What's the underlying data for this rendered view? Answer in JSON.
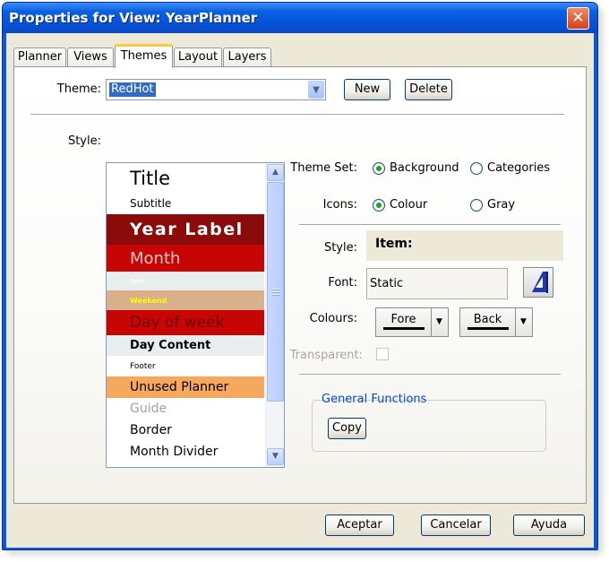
{
  "window": {
    "title": "Properties for View: YearPlanner",
    "close_glyph": "✕"
  },
  "tabs": [
    {
      "label": "Planner"
    },
    {
      "label": "Views"
    },
    {
      "label": "Themes"
    },
    {
      "label": "Layout"
    },
    {
      "label": "Layers"
    }
  ],
  "active_tab": "Themes",
  "theme": {
    "label": "Theme:",
    "value": "RedHot",
    "new_label": "New",
    "delete_label": "Delete"
  },
  "style_list": {
    "label": "Style:",
    "items": [
      {
        "text": "Title",
        "bg": "#ffffff",
        "fg": "#000000"
      },
      {
        "text": "Subtitle",
        "bg": "#ffffff",
        "fg": "#000000"
      },
      {
        "text": "Year Label",
        "bg": "#8b0a0a",
        "fg": "#ffffff"
      },
      {
        "text": "Month",
        "bg": "#c80505",
        "fg": "#f3c6c6"
      },
      {
        "text": "Date",
        "bg": "#e8eeee",
        "fg": "#ffffff"
      },
      {
        "text": "Weekend",
        "bg": "#d9b08c",
        "fg": "#ffff00"
      },
      {
        "text": "Day of week",
        "bg": "#c80505",
        "fg": "#6e0000"
      },
      {
        "text": "Day Content",
        "bg": "#e8eeee",
        "fg": "#000000"
      },
      {
        "text": "Footer",
        "bg": "#ffffff",
        "fg": "#000000"
      },
      {
        "text": "Unused Planner",
        "bg": "#f6a85e",
        "fg": "#000000"
      },
      {
        "text": "Guide",
        "bg": "#ffffff",
        "fg": "#a0a0a0"
      },
      {
        "text": "Border",
        "bg": "#ffffff",
        "fg": "#000000"
      },
      {
        "text": "Month Divider",
        "bg": "#ffffff",
        "fg": "#000000"
      }
    ]
  },
  "theme_set": {
    "label": "Theme Set:",
    "options": [
      "Background",
      "Categories"
    ],
    "selected": "Background"
  },
  "icons": {
    "label": "Icons:",
    "options": [
      "Colour",
      "Gray"
    ],
    "selected": "Colour"
  },
  "style_field": {
    "label": "Style:",
    "value": "Item:"
  },
  "font": {
    "label": "Font:",
    "value": "Static",
    "button_icon": "font-picker-icon"
  },
  "colours": {
    "label": "Colours:",
    "fore_label": "Fore",
    "back_label": "Back"
  },
  "transparent": {
    "label": "Transparent:",
    "checked": false
  },
  "general_functions": {
    "title": "General Functions",
    "copy_label": "Copy"
  },
  "footer": {
    "ok_label": "Aceptar",
    "cancel_label": "Cancelar",
    "help_label": "Ayuda"
  }
}
